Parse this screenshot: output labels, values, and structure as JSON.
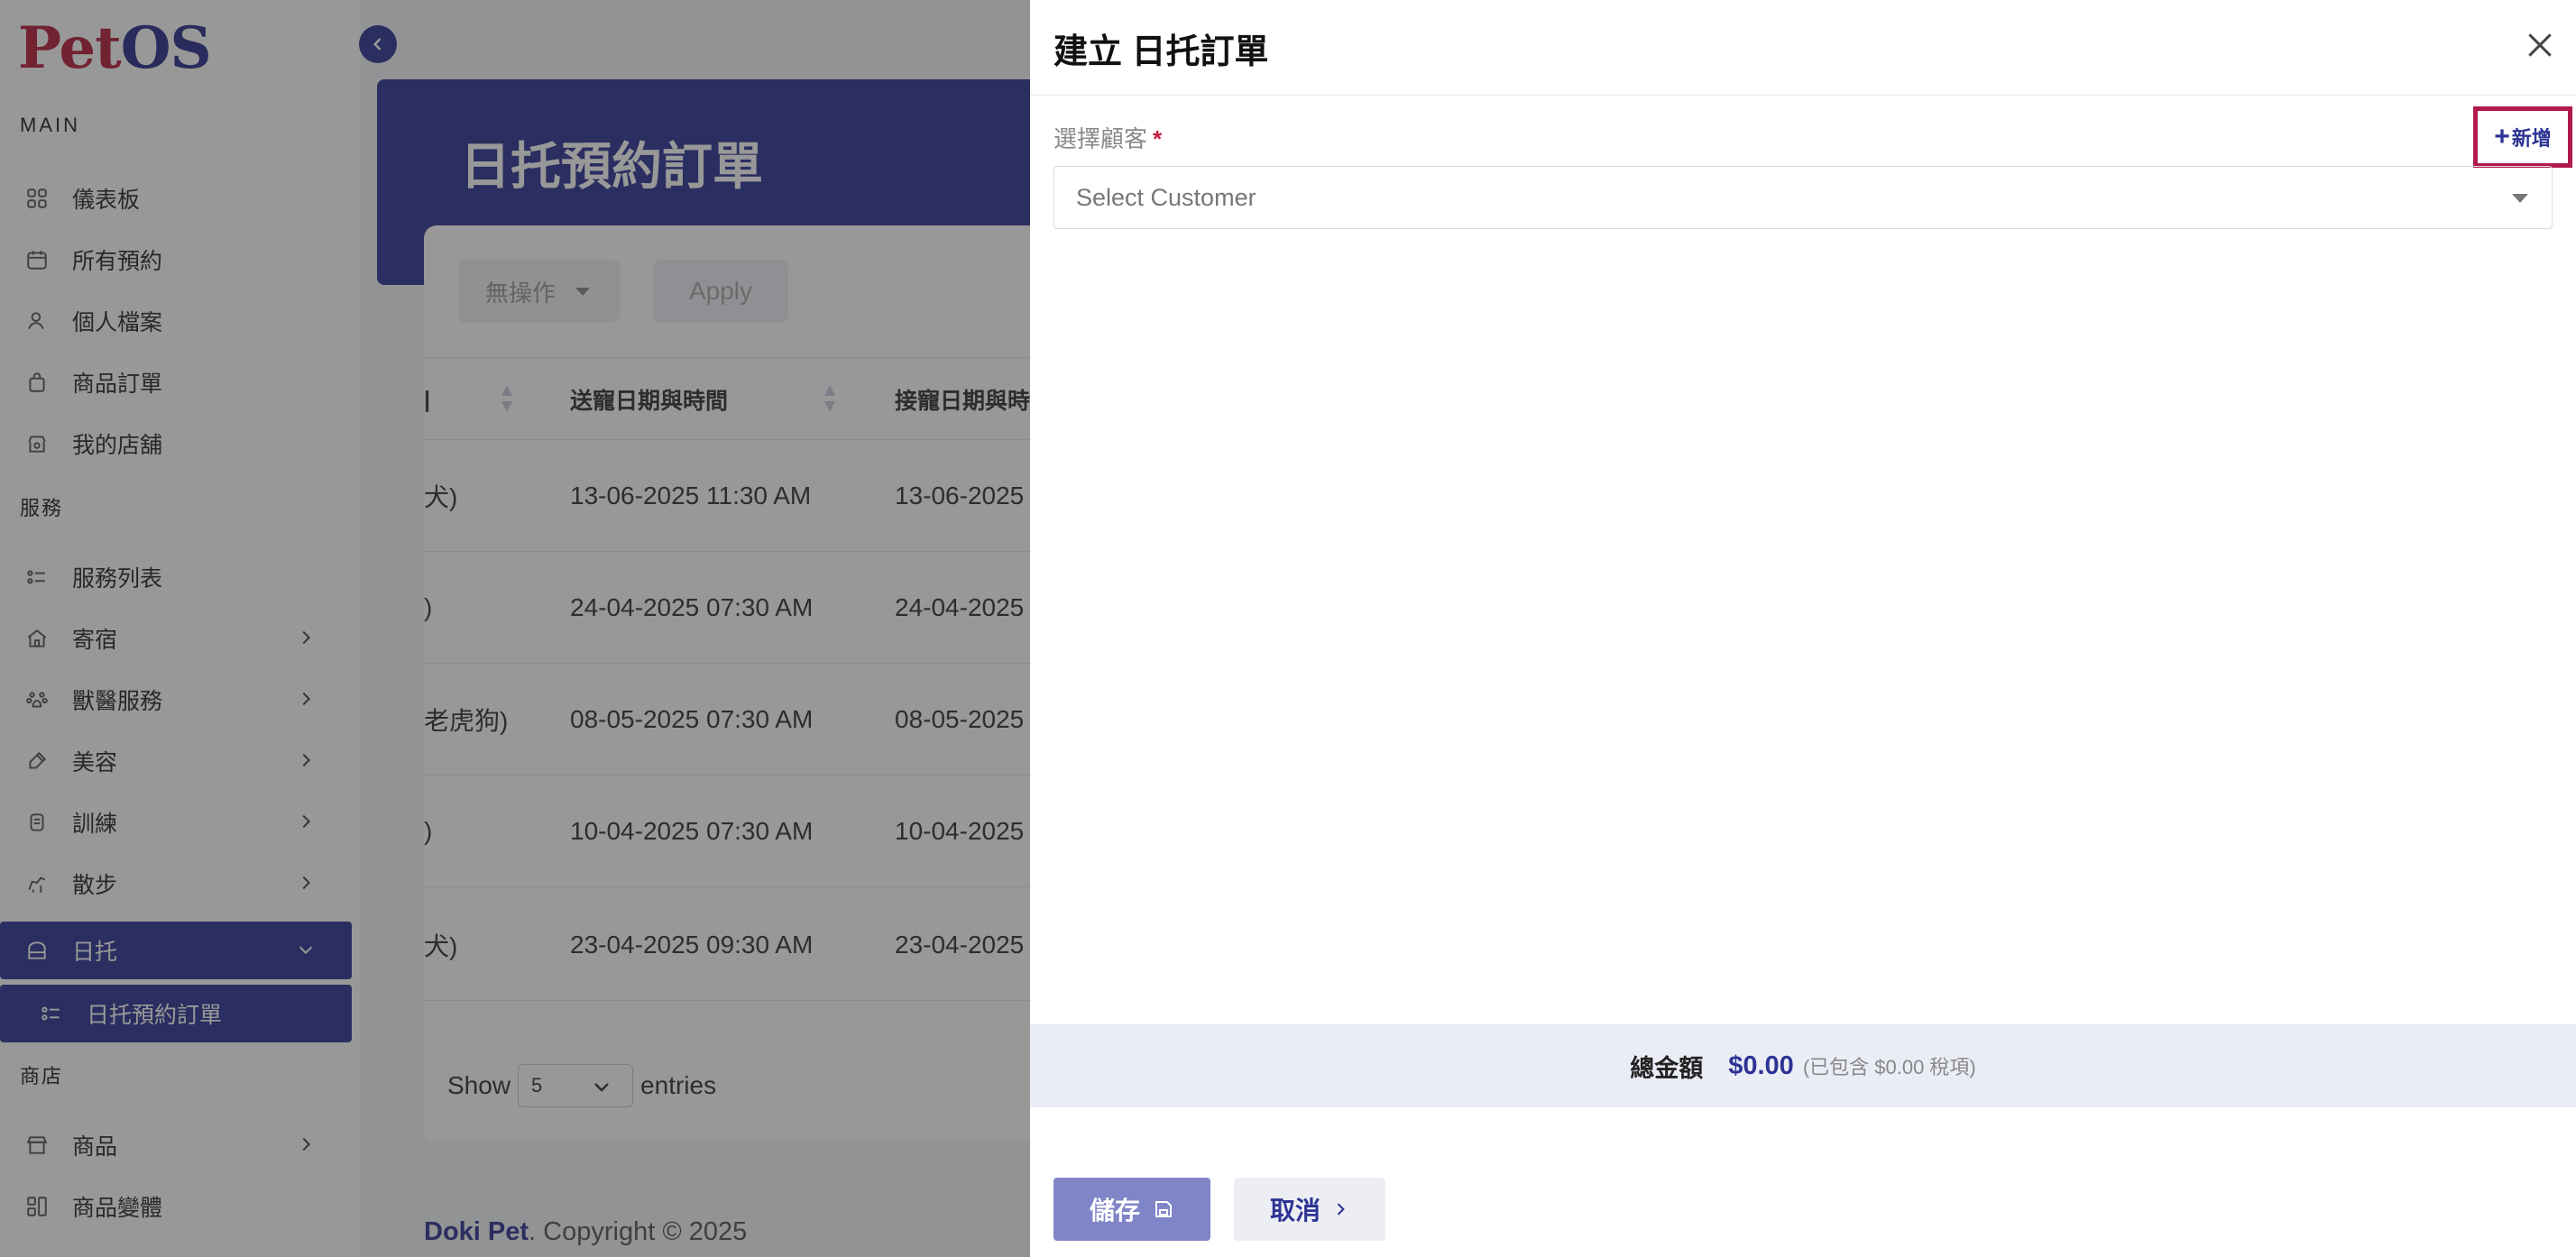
{
  "sidebar": {
    "logo_main": "Pet",
    "logo_accent": "OS",
    "section_main": "MAIN",
    "section_services": "服務",
    "section_store": "商店",
    "items": [
      {
        "label": "儀表板",
        "icon": "dashboard-icon"
      },
      {
        "label": "所有預約",
        "icon": "calendar-icon"
      },
      {
        "label": "個人檔案",
        "icon": "user-icon"
      },
      {
        "label": "商品訂單",
        "icon": "bag-icon"
      },
      {
        "label": "我的店舖",
        "icon": "shop-icon"
      }
    ],
    "service_items": [
      {
        "label": "服務列表",
        "icon": "service-list-icon"
      },
      {
        "label": "寄宿",
        "icon": "home-icon"
      },
      {
        "label": "獸醫服務",
        "icon": "vet-icon"
      },
      {
        "label": "美容",
        "icon": "brush-icon"
      },
      {
        "label": "訓練",
        "icon": "training-icon"
      },
      {
        "label": "散步",
        "icon": "walk-icon"
      },
      {
        "label": "日托",
        "icon": "daycare-icon"
      }
    ],
    "sub_item": "日托預約訂單",
    "store_items": [
      {
        "label": "商品",
        "icon": "store-icon"
      },
      {
        "label": "商品變體",
        "icon": "variant-icon"
      }
    ]
  },
  "page": {
    "title": "日托預約訂單",
    "bulk_action": "無操作",
    "apply": "Apply",
    "columns": [
      "送寵日期與時間",
      "接寵日期與時"
    ],
    "rows": [
      {
        "pet": "犬)",
        "dropoff": "13-06-2025 11:30 AM",
        "pickup": "13-06-2025"
      },
      {
        "pet": ")",
        "dropoff": "24-04-2025 07:30 AM",
        "pickup": "24-04-2025"
      },
      {
        "pet": "老虎狗)",
        "dropoff": "08-05-2025 07:30 AM",
        "pickup": "08-05-2025"
      },
      {
        "pet": ")",
        "dropoff": "10-04-2025 07:30 AM",
        "pickup": "10-04-2025"
      },
      {
        "pet": "犬)",
        "dropoff": "23-04-2025 09:30 AM",
        "pickup": "23-04-2025"
      }
    ],
    "show_label": "Show",
    "show_value": "5",
    "entries_label": "entries",
    "footer_brand": "Doki Pet",
    "footer_text": ". Copyright © 2025"
  },
  "drawer": {
    "title": "建立 日托訂單",
    "customer_label": "選擇顧客",
    "required_mark": "*",
    "add_new": "新增",
    "customer_placeholder": "Select Customer",
    "total_label": "總金額",
    "total_amount": "$0.00",
    "total_note": "(已包含 $0.00 稅項)",
    "save": "儲存",
    "cancel": "取消"
  },
  "colors": {
    "primary": "#2d3494",
    "brand_red": "#b51f3d",
    "highlight": "#b01a4e"
  }
}
